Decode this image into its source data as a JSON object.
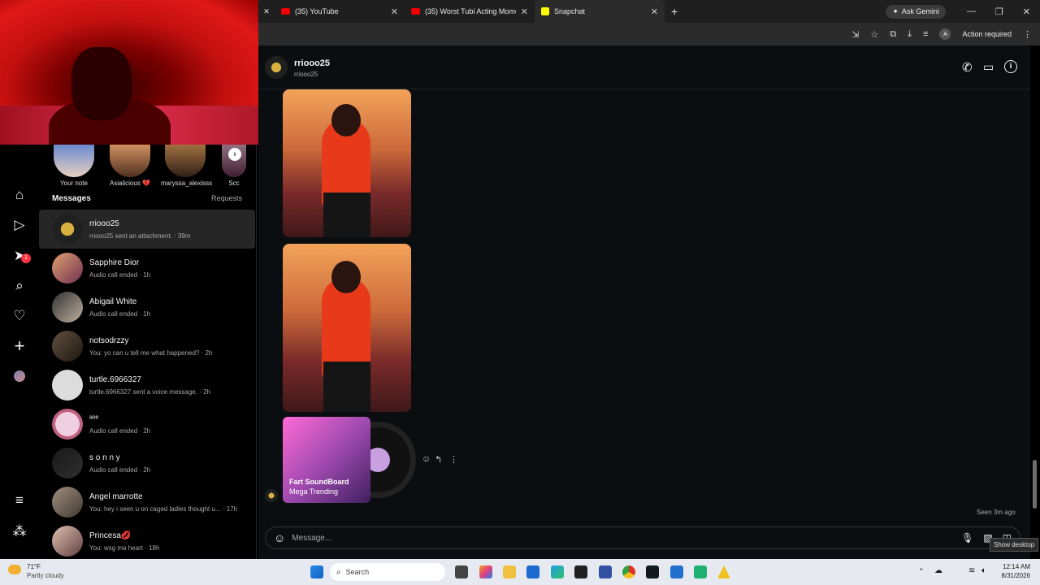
{
  "browser": {
    "tabs": [
      {
        "label": "(35) YouTube"
      },
      {
        "label": "(35) Worst Tubi Acting Momen"
      },
      {
        "label": "Snapchat"
      }
    ],
    "ask_gemini": "Ask Gemini",
    "profile_initial": "A",
    "action_required": "Action required"
  },
  "notes": [
    {
      "label": "Your note"
    },
    {
      "label": "Asialicious 💔"
    },
    {
      "label": "maryssa_alexisss"
    },
    {
      "label": "Scc"
    }
  ],
  "messages_header": {
    "title": "Messages",
    "requests": "Requests"
  },
  "conversations": [
    {
      "name": "rriooo25",
      "sub": "rriooo25 sent an attachment. · 39m"
    },
    {
      "name": "Sapphire Dior",
      "sub": "Audio call ended · 1h"
    },
    {
      "name": "Abigail White",
      "sub": "Audio call ended · 1h"
    },
    {
      "name": "notsodrzzy",
      "sub": "You: yo can u tell me what happened? · 2h"
    },
    {
      "name": "turtle.6966327",
      "sub": "turtle.6966327 sent a voice message. · 2h"
    },
    {
      "name": "ᵃᵒᵉ",
      "sub": "Audio call ended · 2h"
    },
    {
      "name": "s o n n y",
      "sub": "Audio call ended · 2h"
    },
    {
      "name": "Angel marrotte",
      "sub": "You: hey i seen u on caged ladies thought u... · 17h"
    },
    {
      "name": "Princesa💋",
      "sub": "You: wsg ma heart · 18h"
    }
  ],
  "nav_badge": "1",
  "chat": {
    "username": "rriooo25",
    "handle": "rriooo25",
    "reel_title": "Fart SoundBoard",
    "reel_subtitle": "Mega Trending",
    "seen": "Seen 3m ago",
    "composer_placeholder": "Message..."
  },
  "tooltip": "Show desktop",
  "taskbar": {
    "weather_temp": "71°F",
    "weather_desc": "Partly cloudy",
    "search_placeholder": "Search",
    "time": "12:14 AM",
    "date": "8/31/2026"
  }
}
